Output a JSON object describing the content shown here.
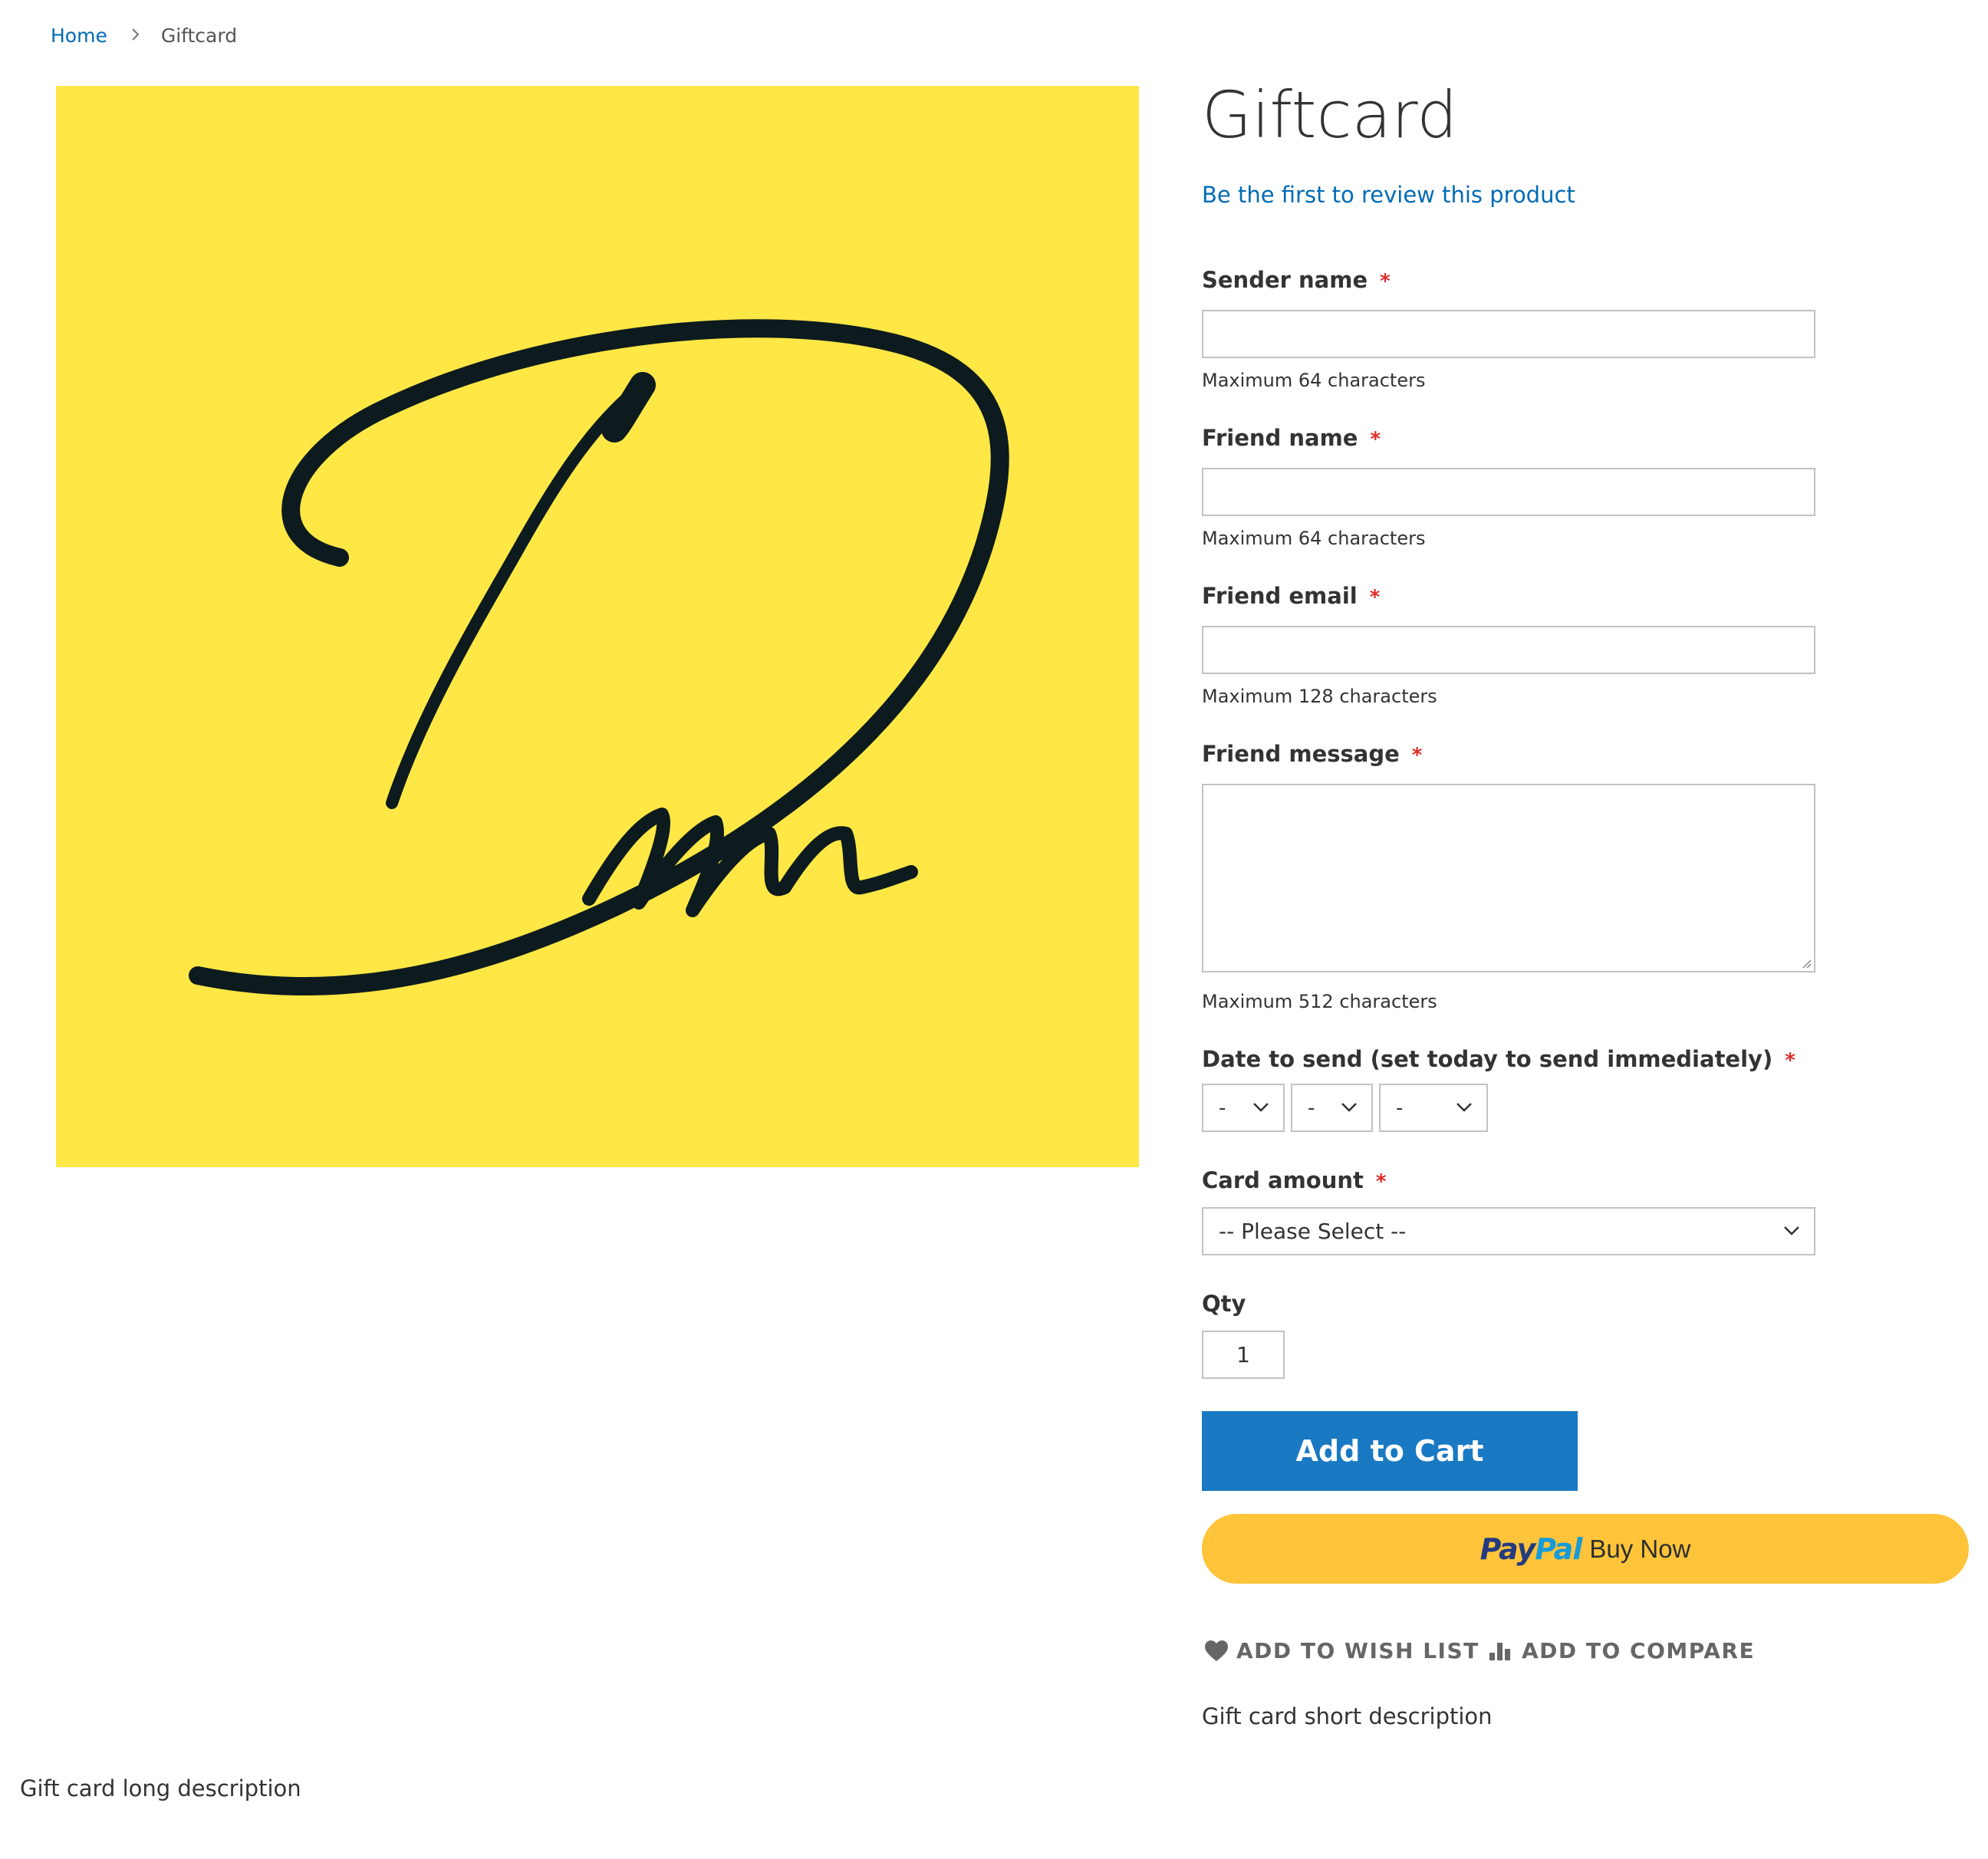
{
  "breadcrumb": {
    "home": "Home",
    "current": "Giftcard"
  },
  "product": {
    "title": "Giftcard",
    "review_link": "Be the first to review this product",
    "image_background": "#ffe746",
    "short_description": "Gift card short description",
    "long_description": "Gift card long description"
  },
  "form": {
    "required_marker": "*",
    "sender_name": {
      "label": "Sender name",
      "value": "",
      "note": "Maximum 64 characters"
    },
    "friend_name": {
      "label": "Friend name",
      "value": "",
      "note": "Maximum 64 characters"
    },
    "friend_email": {
      "label": "Friend email",
      "value": "",
      "note": "Maximum 128 characters"
    },
    "friend_message": {
      "label": "Friend message",
      "value": "",
      "note": "Maximum 512 characters"
    },
    "date_to_send": {
      "label": "Date to send (set today to send immediately)",
      "day": "-",
      "month": "-",
      "year": "-"
    },
    "card_amount": {
      "label": "Card amount",
      "selected": "-- Please Select --"
    },
    "qty": {
      "label": "Qty",
      "value": "1"
    }
  },
  "actions": {
    "add_to_cart": "Add to Cart",
    "paypal_pay": "Pay",
    "paypal_pal": "Pal",
    "paypal_text": "Buy Now",
    "wishlist": "ADD TO WISH LIST",
    "compare": "ADD TO COMPARE"
  },
  "colors": {
    "link": "#006bb4",
    "primary_button": "#1979c3",
    "paypal_button": "#ffc439",
    "required": "#e02b27"
  },
  "icons": {
    "breadcrumb_separator": "chevron-right-icon",
    "select_arrow": "chevron-down-icon",
    "wishlist": "heart-icon",
    "compare": "bar-chart-icon"
  }
}
